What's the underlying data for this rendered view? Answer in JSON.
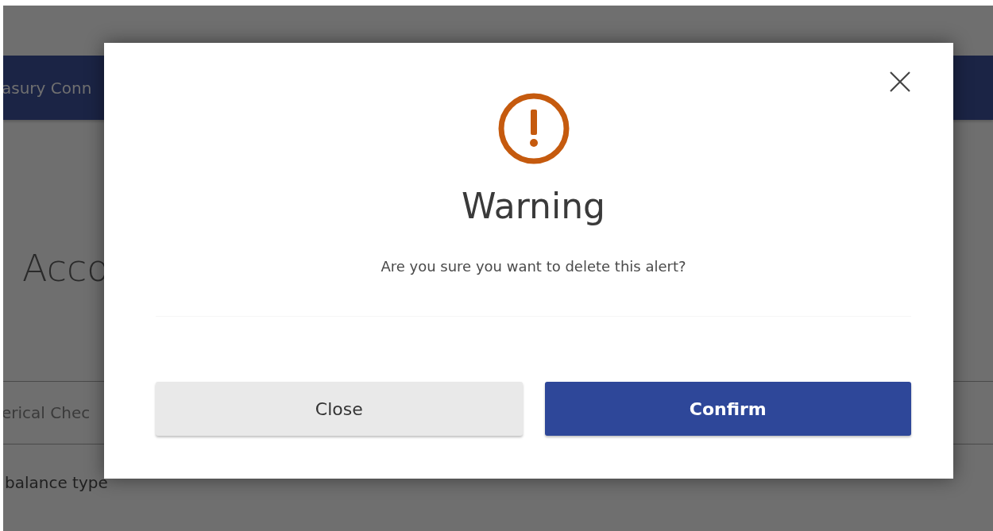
{
  "background": {
    "header_title": "asury Conn",
    "page_title": "Acco",
    "row_label": "erical Chec",
    "field_label": "balance type"
  },
  "dialog": {
    "title": "Warning",
    "message": "Are you sure you want to delete this alert?",
    "buttons": [
      {
        "label": "Close",
        "kind": "secondary"
      },
      {
        "label": "Confirm",
        "kind": "primary"
      }
    ]
  }
}
